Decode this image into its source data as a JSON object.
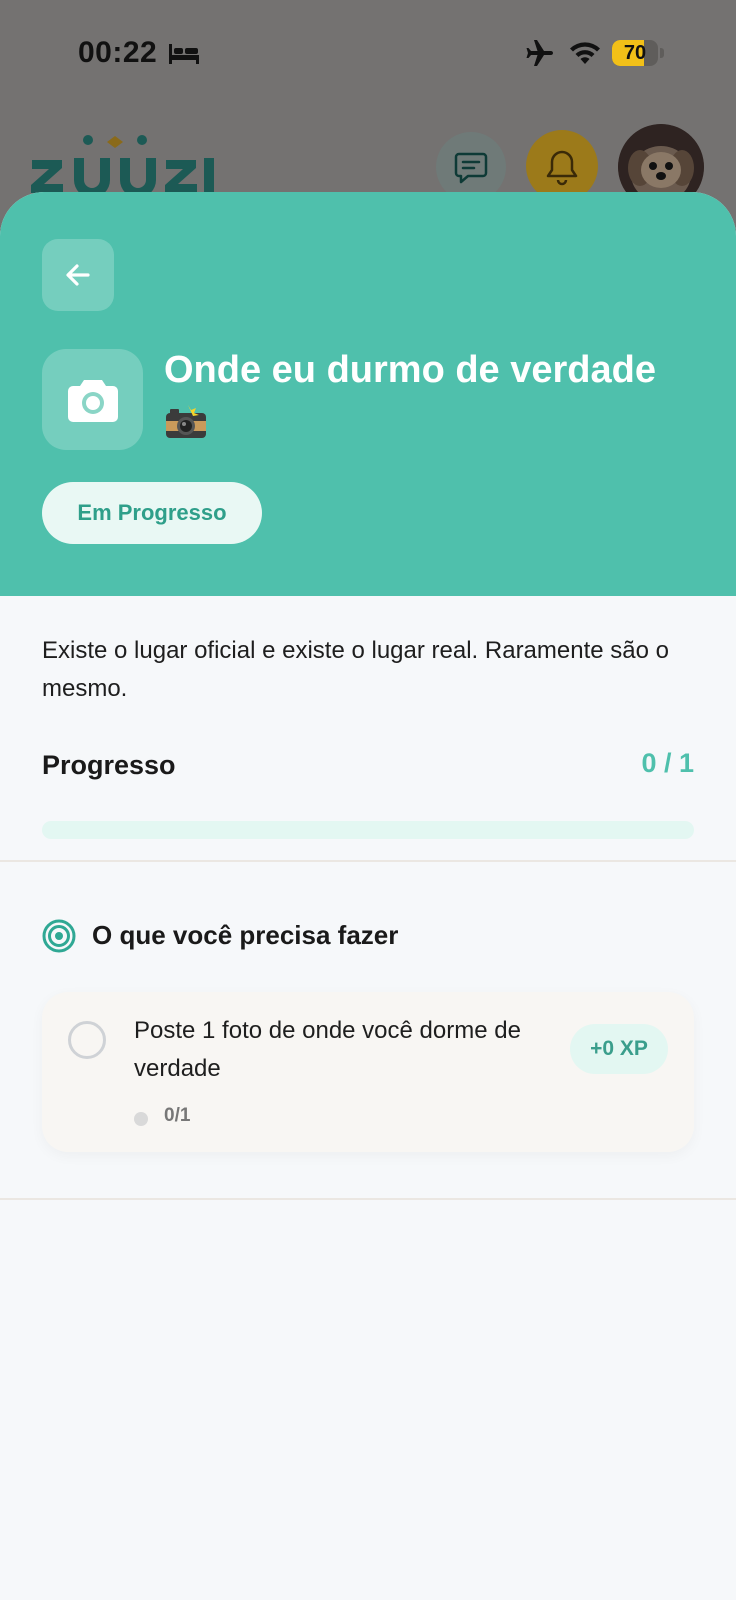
{
  "status_bar": {
    "time": "00:22",
    "battery_level": 70,
    "battery_label": "70",
    "icons": [
      "bed-icon",
      "airplane-icon",
      "wifi-icon",
      "battery-icon"
    ]
  },
  "background_app": {
    "logo_text": "zuuzi",
    "icons": [
      "chat-icon",
      "bell-icon",
      "avatar"
    ]
  },
  "task": {
    "title": "Onde eu durmo de verdade",
    "emoji_icon": "camera-flash-emoji",
    "icon": "camera-icon",
    "status": "Em Progresso",
    "description": "Existe o lugar oficial e existe o lugar real. Raramente são o mesmo."
  },
  "progress": {
    "label": "Progresso",
    "value_text": "0 / 1",
    "current": 0,
    "total": 1
  },
  "requirements": {
    "section_title": "O que você precisa fazer",
    "items": [
      {
        "text": "Poste 1 foto de onde você dorme de verdade",
        "count": "0/1",
        "xp": "+0 XP",
        "completed": false
      }
    ]
  },
  "colors": {
    "accent": "#4fc0ac",
    "accent_light": "#e3f7f2",
    "sheet_background": "#f6f8fa",
    "overlay": "#747271"
  }
}
